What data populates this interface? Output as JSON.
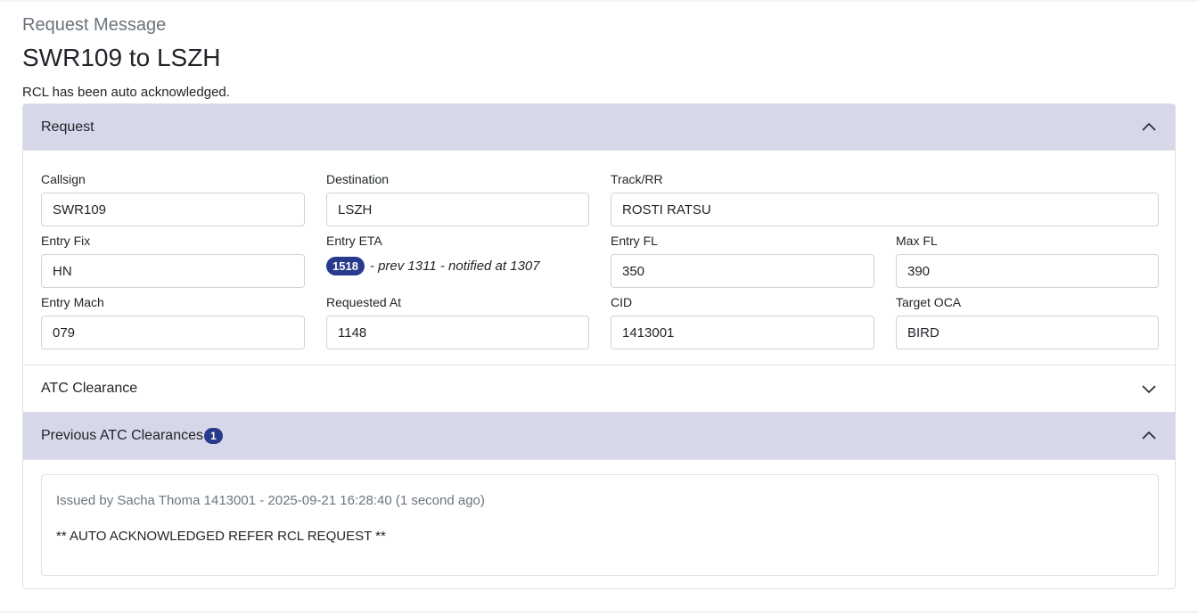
{
  "page": {
    "subtitle": "Request Message",
    "title": "SWR109 to LSZH",
    "notice": "RCL has been auto acknowledged."
  },
  "request": {
    "header": "Request",
    "fields": {
      "callsign": {
        "label": "Callsign",
        "value": "SWR109"
      },
      "destination": {
        "label": "Destination",
        "value": "LSZH"
      },
      "track": {
        "label": "Track/RR",
        "value": "ROSTI RATSU"
      },
      "entry_fix": {
        "label": "Entry Fix",
        "value": "HN"
      },
      "entry_eta": {
        "label": "Entry ETA",
        "badge": "1518",
        "detail": "- prev 1311 - notified at 1307"
      },
      "entry_fl": {
        "label": "Entry FL",
        "value": "350"
      },
      "max_fl": {
        "label": "Max FL",
        "value": "390"
      },
      "entry_mach": {
        "label": "Entry Mach",
        "value": "079"
      },
      "requested_at": {
        "label": "Requested At",
        "value": "1148"
      },
      "cid": {
        "label": "CID",
        "value": "1413001"
      },
      "target_oca": {
        "label": "Target OCA",
        "value": "BIRD"
      }
    }
  },
  "atc_clearance": {
    "header": "ATC Clearance"
  },
  "previous": {
    "header": "Previous ATC Clearances",
    "count": "1",
    "items": [
      {
        "meta": "Issued by Sacha Thoma 1413001 - 2025-09-21 16:28:40 (1 second ago)",
        "text": "** AUTO ACKNOWLEDGED REFER RCL REQUEST **"
      }
    ]
  },
  "icons": {
    "collapse": "chevron-up-icon",
    "expand": "chevron-down-icon"
  }
}
